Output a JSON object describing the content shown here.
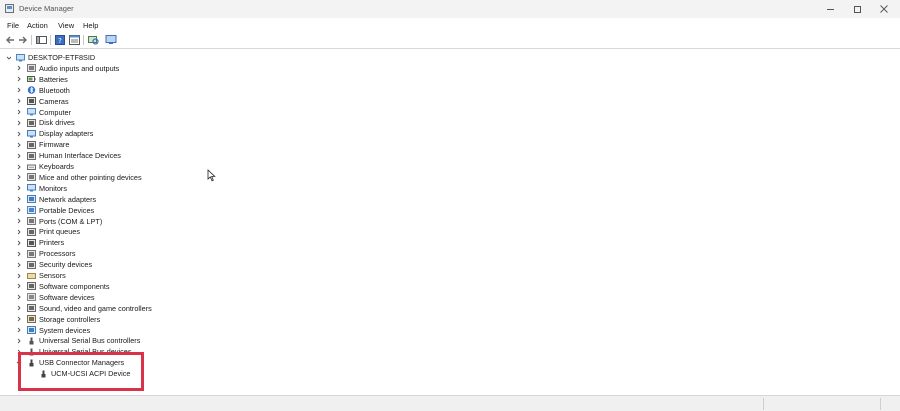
{
  "window": {
    "title": "Device Manager"
  },
  "menu": {
    "file": "File",
    "action": "Action",
    "view": "View",
    "help": "Help"
  },
  "toolbar": {
    "icons": [
      "back-arrow-icon",
      "forward-arrow-icon",
      "show-hide-console-tree-icon",
      "help-icon",
      "properties-icon",
      "scan-hardware-icon",
      "update-driver-icon"
    ]
  },
  "tree": {
    "root": "DESKTOP-ETF8SID",
    "categories": [
      {
        "label": "Audio inputs and outputs",
        "icon": "speaker-icon"
      },
      {
        "label": "Batteries",
        "icon": "battery-icon"
      },
      {
        "label": "Bluetooth",
        "icon": "bluetooth-icon"
      },
      {
        "label": "Cameras",
        "icon": "camera-icon"
      },
      {
        "label": "Computer",
        "icon": "computer-icon"
      },
      {
        "label": "Disk drives",
        "icon": "disk-drive-icon"
      },
      {
        "label": "Display adapters",
        "icon": "display-adapter-icon"
      },
      {
        "label": "Firmware",
        "icon": "firmware-icon"
      },
      {
        "label": "Human Interface Devices",
        "icon": "hid-icon"
      },
      {
        "label": "Keyboards",
        "icon": "keyboard-icon"
      },
      {
        "label": "Mice and other pointing devices",
        "icon": "mouse-icon"
      },
      {
        "label": "Monitors",
        "icon": "monitor-icon"
      },
      {
        "label": "Network adapters",
        "icon": "network-adapter-icon"
      },
      {
        "label": "Portable Devices",
        "icon": "portable-device-icon"
      },
      {
        "label": "Ports (COM & LPT)",
        "icon": "port-icon"
      },
      {
        "label": "Print queues",
        "icon": "print-queue-icon"
      },
      {
        "label": "Printers",
        "icon": "printer-icon"
      },
      {
        "label": "Processors",
        "icon": "processor-icon"
      },
      {
        "label": "Security devices",
        "icon": "security-device-icon"
      },
      {
        "label": "Sensors",
        "icon": "sensor-icon"
      },
      {
        "label": "Software components",
        "icon": "software-component-icon"
      },
      {
        "label": "Software devices",
        "icon": "software-device-icon"
      },
      {
        "label": "Sound, video and game controllers",
        "icon": "sound-controller-icon"
      },
      {
        "label": "Storage controllers",
        "icon": "storage-controller-icon"
      },
      {
        "label": "System devices",
        "icon": "system-device-icon"
      },
      {
        "label": "Universal Serial Bus controllers",
        "icon": "usb-controller-icon"
      },
      {
        "label": "Universal Serial Bus devices",
        "icon": "usb-device-icon"
      },
      {
        "label": "USB Connector Managers",
        "icon": "usb-connector-icon",
        "expanded": true,
        "children": [
          {
            "label": "UCM-UCSI ACPI Device",
            "icon": "usb-connector-icon"
          }
        ]
      }
    ]
  },
  "colors": {
    "highlight": "#d9334a",
    "titlebar": "#f3f3f3",
    "statusbar": "#f0f0f0"
  }
}
